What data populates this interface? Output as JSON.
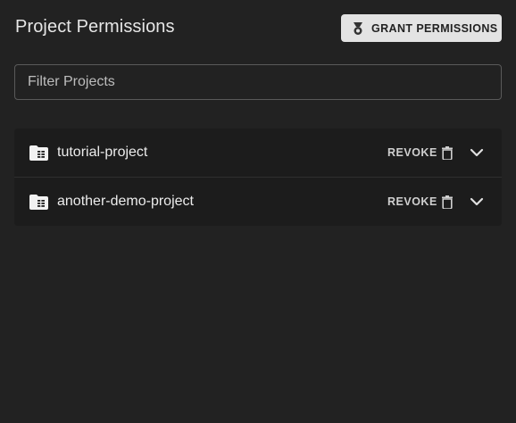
{
  "header": {
    "title": "Project Permissions",
    "grant_label": "GRANT PERMISSIONS",
    "grant_icon": "medal-icon"
  },
  "filter": {
    "placeholder": "Filter Projects",
    "value": ""
  },
  "projects": [
    {
      "name": "tutorial-project",
      "revoke_label": "REVOKE"
    },
    {
      "name": "another-demo-project",
      "revoke_label": "REVOKE"
    }
  ],
  "colors": {
    "background": "#222222",
    "list_background": "#1c1c1c",
    "button_background": "#e3e3e3"
  }
}
